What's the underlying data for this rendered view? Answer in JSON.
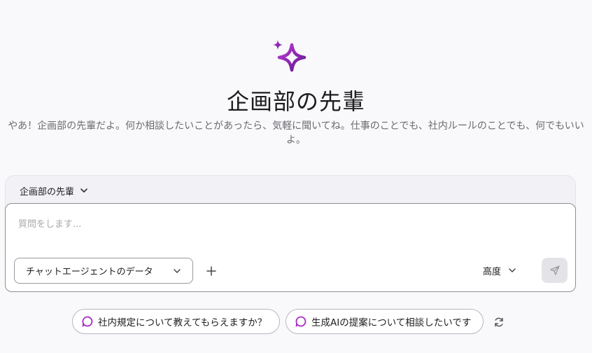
{
  "header": {
    "logo_icon": "sparkle-icon",
    "title": "企画部の先輩",
    "greeting": "やあ！企画部の先輩だよ。何か相談したいことがあったら、気軽に聞いてね。仕事のことでも、社内ルールのことでも、何でもいいよ。"
  },
  "agent_selector": {
    "label": "企画部の先輩",
    "icon": "chevron-down-icon"
  },
  "composer": {
    "placeholder": "質問をします...",
    "value": "",
    "data_source": "チャットエージェントのデータ",
    "add_icon": "plus-icon",
    "mode": "高度",
    "send_icon": "send-icon"
  },
  "suggestions": [
    {
      "label": "社内規定について教えてもらえますか？",
      "icon": "chat-bubble-icon"
    },
    {
      "label": "生成AIの提案について相談したいです",
      "icon": "chat-bubble-icon"
    }
  ],
  "refresh_icon": "refresh-icon",
  "colors": {
    "accent_start": "#b72fd0",
    "accent_end": "#6a1b9a",
    "background": "#f9f9fb"
  }
}
